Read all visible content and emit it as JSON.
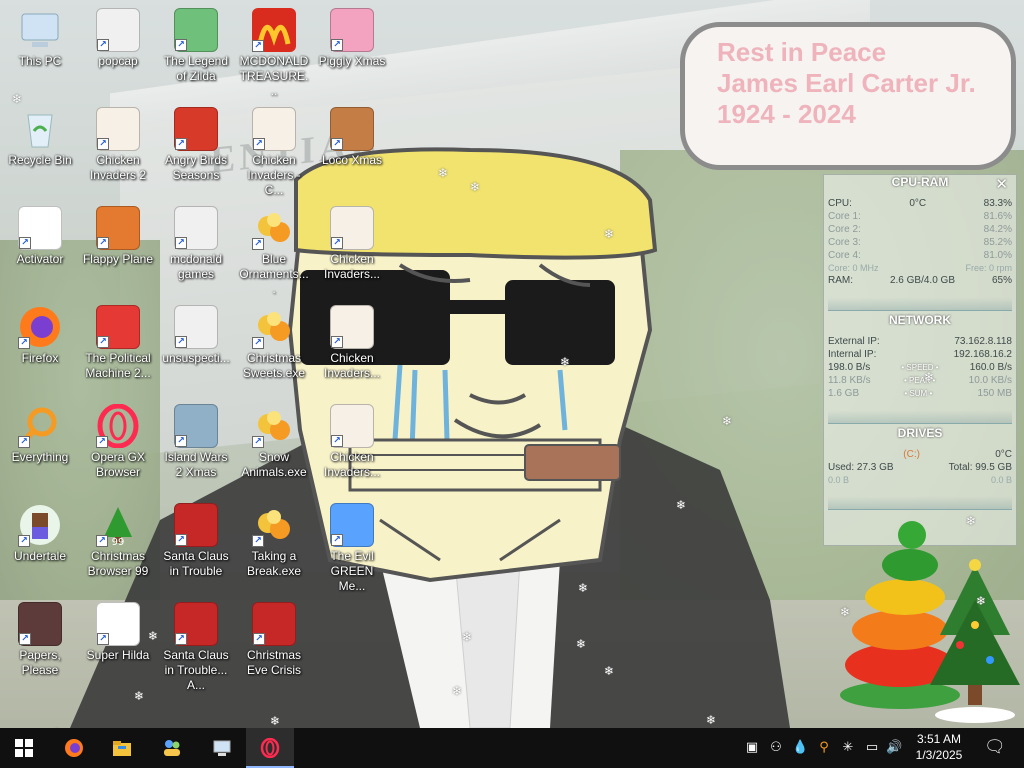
{
  "bubble": {
    "line1": "Rest in Peace",
    "line2": "James Earl Carter Jr.",
    "line3": "1924 - 2024"
  },
  "wallpaper": {
    "sign": "ENTIAL"
  },
  "icons": [
    {
      "label": "This PC",
      "icon": "computer-icon"
    },
    {
      "label": "popcap",
      "icon": "folder-icon"
    },
    {
      "label": "The Legend of Zilda",
      "icon": "game-icon"
    },
    {
      "label": "MCDONALD TREASURE...",
      "icon": "mcdonalds-icon"
    },
    {
      "label": "Piggly Xmas",
      "icon": "pig-icon"
    },
    {
      "label": "Recycle Bin",
      "icon": "recycle-bin-icon"
    },
    {
      "label": "Chicken Invaders 2",
      "icon": "chicken-icon"
    },
    {
      "label": "Angry Birds Seasons",
      "icon": "angry-bird-icon"
    },
    {
      "label": "Chicken Invaders - C...",
      "icon": "chicken-icon"
    },
    {
      "label": "Loco Xmas",
      "icon": "gingerbread-icon"
    },
    {
      "label": "Activator",
      "icon": "app-icon"
    },
    {
      "label": "Flappy Plane",
      "icon": "plane-icon"
    },
    {
      "label": "mcdonald games",
      "icon": "folder-icon"
    },
    {
      "label": "Blue Ornaments....",
      "icon": "ornament-icon"
    },
    {
      "label": "Chicken Invaders...",
      "icon": "chicken-icon"
    },
    {
      "label": "Firefox",
      "icon": "firefox-icon"
    },
    {
      "label": "The Political Machine 2...",
      "icon": "political-icon"
    },
    {
      "label": "unsuspecti...",
      "icon": "folder-icon"
    },
    {
      "label": "Christmas Sweets.exe",
      "icon": "ornament-icon"
    },
    {
      "label": "Chicken Invaders...",
      "icon": "chicken-icon"
    },
    {
      "label": "Everything",
      "icon": "search-icon"
    },
    {
      "label": "Opera GX Browser",
      "icon": "opera-gx-icon"
    },
    {
      "label": "Island Wars 2 Xmas",
      "icon": "island-icon"
    },
    {
      "label": "Snow Animals.exe",
      "icon": "ornament-icon"
    },
    {
      "label": "Chicken Invaders...",
      "icon": "chicken-icon"
    },
    {
      "label": "Undertale",
      "icon": "undertale-icon"
    },
    {
      "label": "Christmas Browser 99",
      "icon": "tree-icon"
    },
    {
      "label": "Santa Claus in Trouble",
      "icon": "santa-icon"
    },
    {
      "label": "Taking a Break.exe",
      "icon": "ornament-icon"
    },
    {
      "label": "The Evil GREEN Me...",
      "icon": "people-icon"
    },
    {
      "label": "Papers, Please",
      "icon": "papers-icon"
    },
    {
      "label": "Super Hilda",
      "icon": "pixel-icon"
    },
    {
      "label": "Santa Claus in Trouble... A...",
      "icon": "santa-icon"
    },
    {
      "label": "Christmas Eve Crisis",
      "icon": "santa-icon"
    }
  ],
  "widget": {
    "cpu_title": "CPU-RAM",
    "cpu_label": "CPU:",
    "cpu_temp": "0°C",
    "cpu_value": "83.3%",
    "cores": [
      {
        "label": "Core 1:",
        "value": "81.6%"
      },
      {
        "label": "Core 2:",
        "value": "84.2%"
      },
      {
        "label": "Core 3:",
        "value": "85.2%"
      },
      {
        "label": "Core 4:",
        "value": "81.0%"
      }
    ],
    "cpu_freq_left": "Core: 0 MHz",
    "cpu_freq_right": "Free: 0 rpm",
    "ram_label": "RAM:",
    "ram_usage": "2.6 GB/4.0 GB",
    "ram_pct": "65%",
    "net_title": "NETWORK",
    "ext_ip_label": "External IP:",
    "ext_ip": "73.162.8.118",
    "int_ip_label": "Internal IP:",
    "int_ip": "192.168.16.2",
    "speed_down": "198.0 B/s",
    "speed_label": "• SPEED •",
    "speed_up": "160.0 B/s",
    "peak_down": "11.8 KB/s",
    "peak_label": "• PEAK •",
    "peak_up": "10.0 KB/s",
    "sum_down": "1.6 GB",
    "sum_label": "• SUM •",
    "sum_up": "150 MB",
    "drives_title": "DRIVES",
    "drive_letter": "(C:)",
    "drive_temp": "0°C",
    "drive_used": "Used: 27.3 GB",
    "drive_total": "Total: 99.5 GB",
    "drive_read": "0.0 B",
    "drive_write": "0.0 B"
  },
  "taskbar": {
    "start": "start-icon",
    "apps": [
      "firefox-icon",
      "file-explorer-icon",
      "people-icon",
      "computer-icon",
      "opera-gx-icon"
    ],
    "tray": [
      "notes-icon",
      "people-icon",
      "water-drop-icon",
      "search-icon",
      "snowflake-icon",
      "network-icon",
      "volume-icon"
    ],
    "time": "3:51 AM",
    "date": "1/3/2025",
    "notification": "notification-icon"
  }
}
